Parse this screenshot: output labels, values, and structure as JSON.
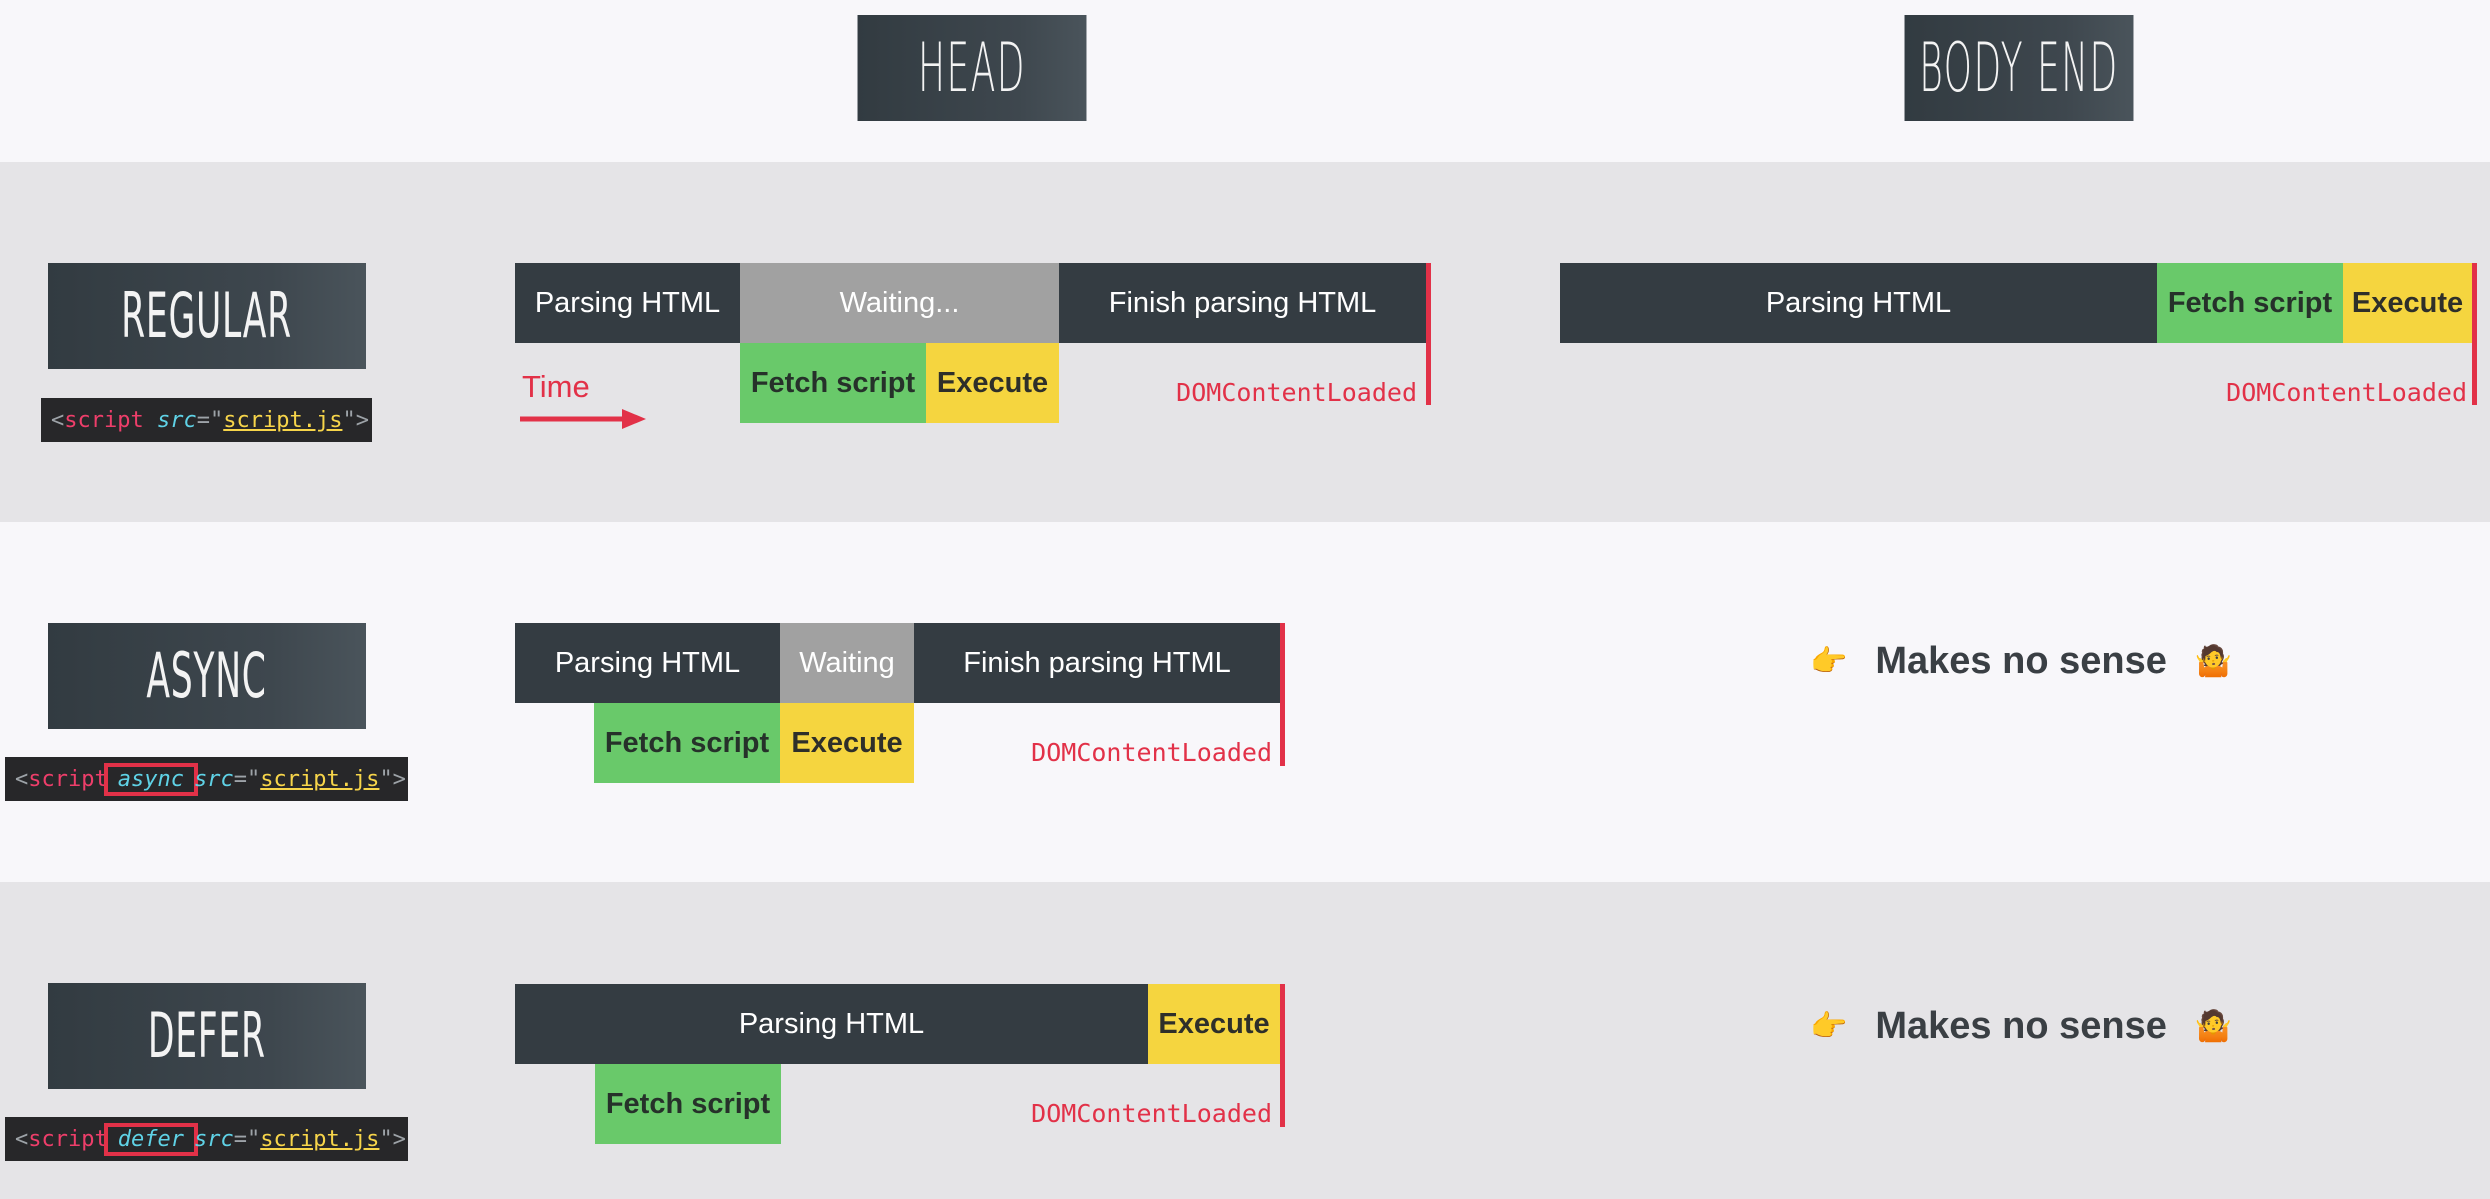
{
  "columns": {
    "head": "HEAD",
    "body_end": "BODY END"
  },
  "rows": {
    "regular": {
      "label": "REGULAR",
      "code": {
        "open": "<",
        "tag": "script",
        "attr": "src",
        "eq": "=\"",
        "value": "script.js",
        "close": "\">"
      },
      "head_timeline": {
        "parsing": "Parsing HTML",
        "waiting": "Waiting...",
        "finish": "Finish parsing HTML",
        "fetch": "Fetch script",
        "execute": "Execute",
        "dcl": "DOMContentLoaded",
        "time": "Time"
      },
      "body_timeline": {
        "parsing": "Parsing HTML",
        "fetch": "Fetch script",
        "execute": "Execute",
        "dcl": "DOMContentLoaded"
      }
    },
    "async": {
      "label": "ASYNC",
      "code": {
        "open": "<",
        "tag": "script",
        "highlight": "async",
        "attr": "src",
        "eq": "=\"",
        "value": "script.js",
        "close": "\">"
      },
      "head_timeline": {
        "parsing": "Parsing HTML",
        "waiting": "Waiting",
        "finish": "Finish parsing HTML",
        "fetch": "Fetch script",
        "execute": "Execute",
        "dcl": "DOMContentLoaded"
      },
      "body_note": {
        "icon": "👉",
        "text": "Makes no sense",
        "emoji": "🤷"
      }
    },
    "defer": {
      "label": "DEFER",
      "code": {
        "open": "<",
        "tag": "script",
        "highlight": "defer",
        "attr": "src",
        "eq": "=\"",
        "value": "script.js",
        "close": "\">"
      },
      "head_timeline": {
        "parsing": "Parsing HTML",
        "execute": "Execute",
        "fetch": "Fetch script",
        "dcl": "DOMContentLoaded"
      },
      "body_note": {
        "icon": "👉",
        "text": "Makes no sense",
        "emoji": "🤷"
      }
    }
  },
  "colors": {
    "dark": "#343c42",
    "waiting": "#a1a1a1",
    "fetch": "#69c96a",
    "execute": "#f5d53f",
    "accent": "#e23148"
  }
}
